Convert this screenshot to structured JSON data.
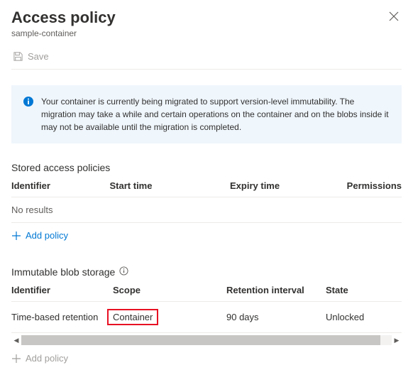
{
  "header": {
    "title": "Access policy",
    "subtitle": "sample-container"
  },
  "toolbar": {
    "save_label": "Save"
  },
  "banner": {
    "message": "Your container is currently being migrated to support version-level immutability. The migration may take a while and certain operations on the container and on the blobs inside it may not be available until the migration is completed."
  },
  "stored_policies": {
    "section_title": "Stored access policies",
    "columns": {
      "identifier": "Identifier",
      "start": "Start time",
      "expiry": "Expiry time",
      "permissions": "Permissions"
    },
    "no_results": "No results",
    "add_label": "Add policy"
  },
  "immutable": {
    "section_title": "Immutable blob storage",
    "columns": {
      "identifier": "Identifier",
      "scope": "Scope",
      "retention": "Retention interval",
      "state": "State"
    },
    "rows": [
      {
        "identifier": "Time-based retention",
        "scope": "Container",
        "retention": "90 days",
        "state": "Unlocked"
      }
    ],
    "add_label": "Add policy"
  }
}
